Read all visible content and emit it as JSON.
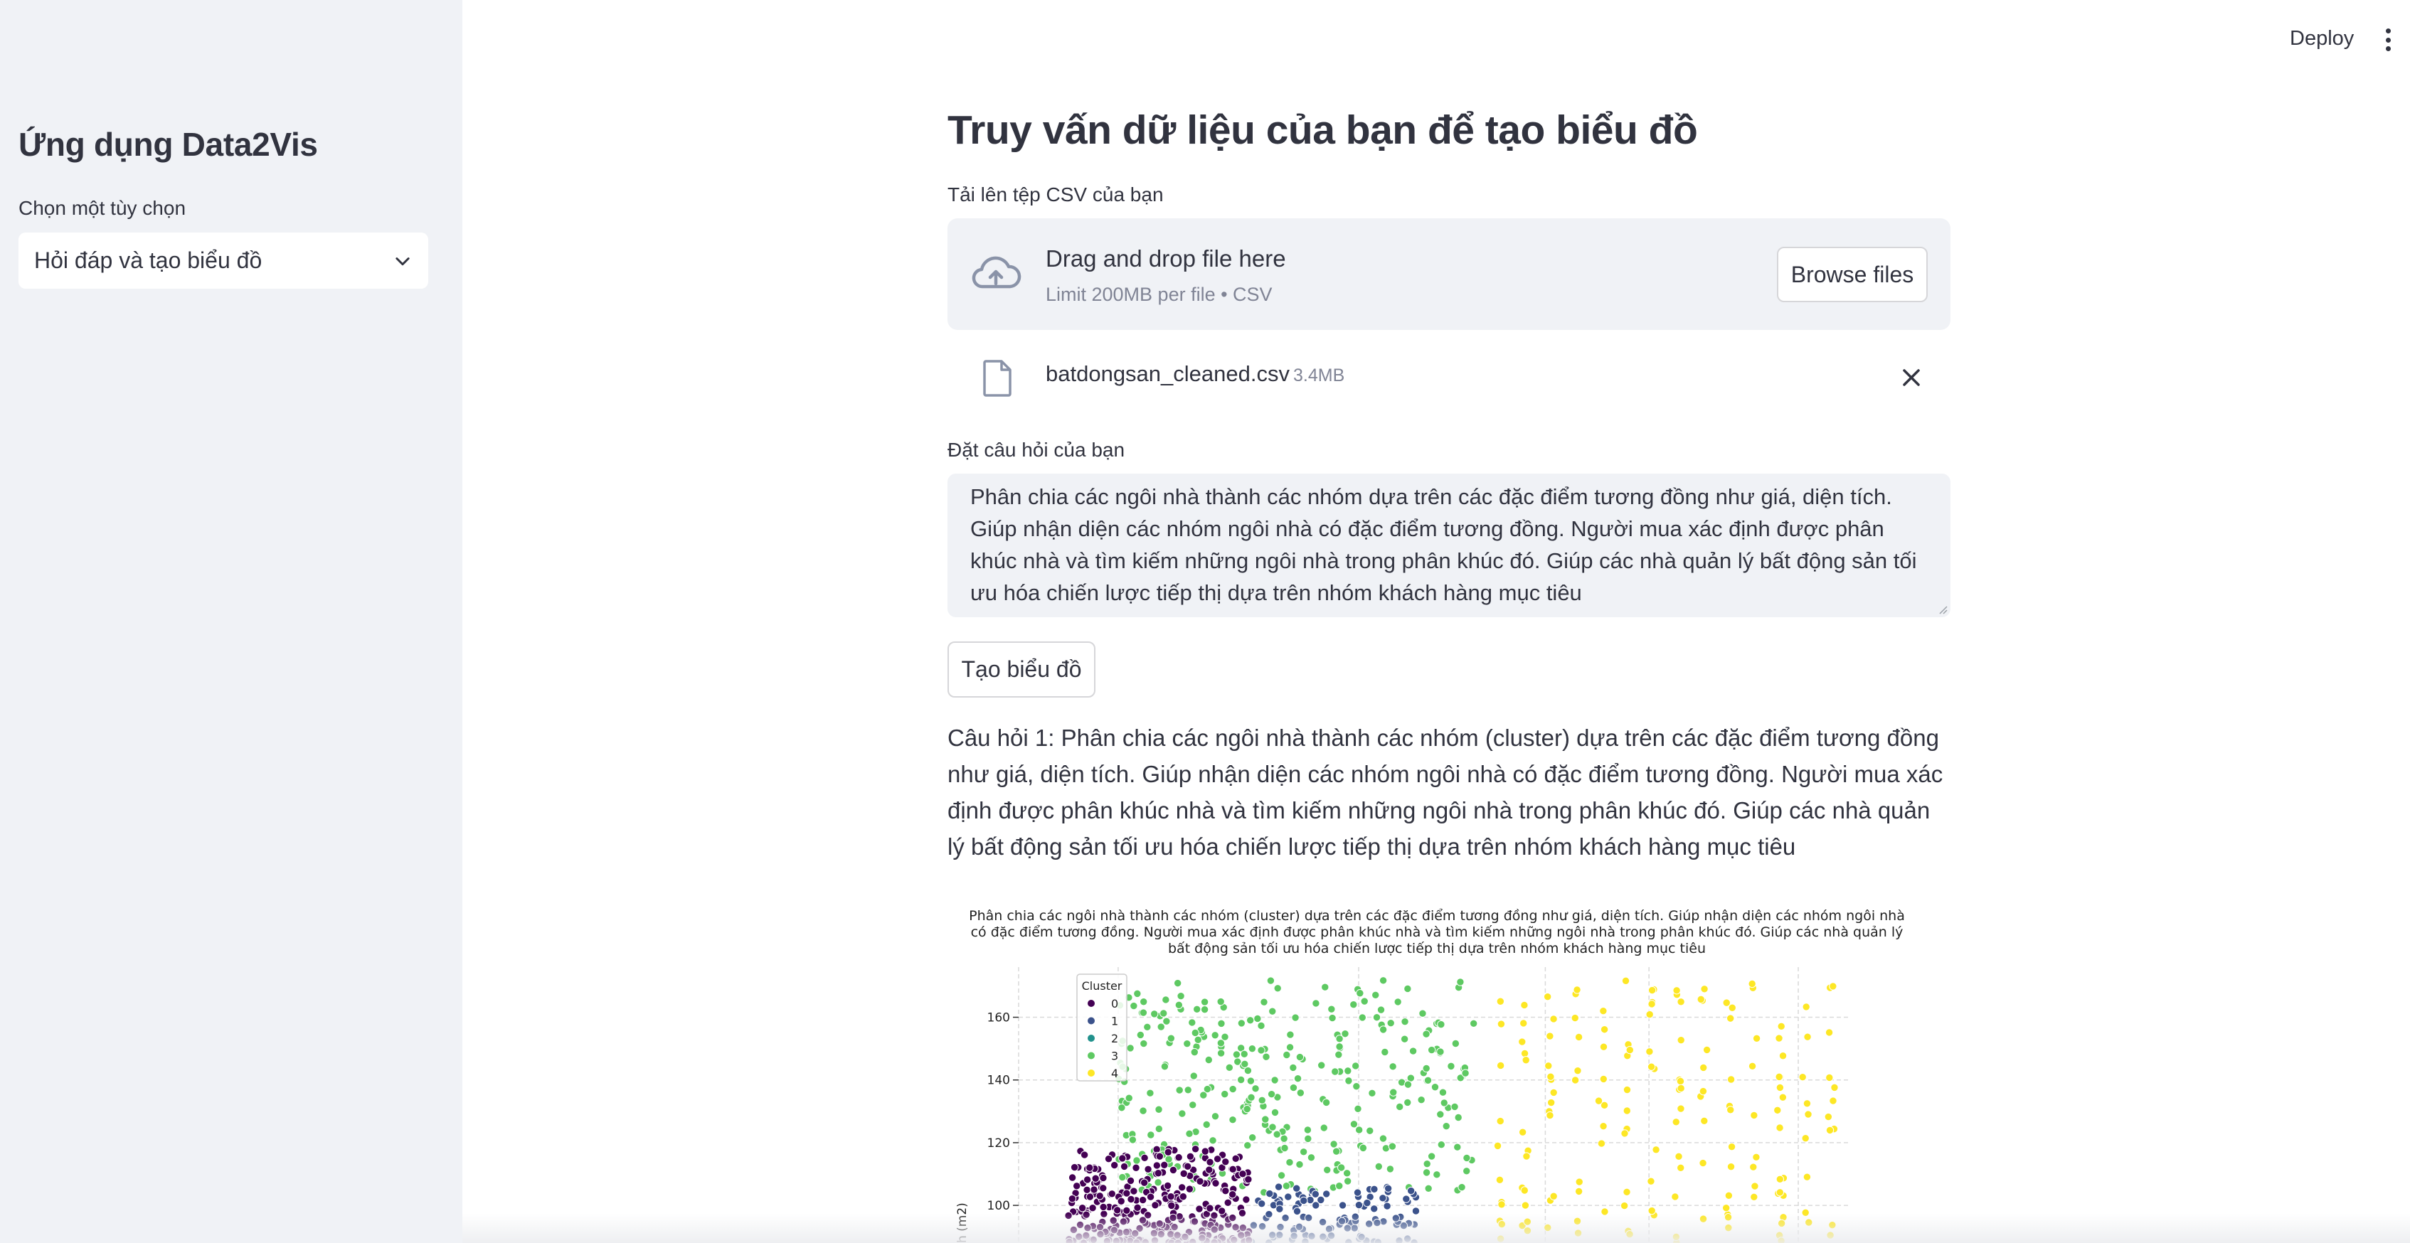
{
  "sidebar": {
    "title": "Ứng dụng Data2Vis",
    "select_label": "Chọn một tùy chọn",
    "select_value": "Hỏi đáp và tạo biểu đồ",
    "select_icon": "chevron-down-icon"
  },
  "header": {
    "deploy_label": "Deploy",
    "menu_icon": "kebab-menu-icon"
  },
  "main": {
    "title": "Truy vấn dữ liệu của bạn để tạo biểu đồ",
    "upload": {
      "label": "Tải lên tệp CSV của bạn",
      "drop_text": "Drag and drop file here",
      "limit_text": "Limit 200MB per file • CSV",
      "browse_label": "Browse files",
      "icon": "cloud-upload-icon"
    },
    "uploaded_file": {
      "name": "batdongsan_cleaned.csv",
      "size": "3.4MB"
    },
    "question": {
      "label": "Đặt câu hỏi của bạn",
      "value": "Phân chia các ngôi nhà thành các nhóm dựa trên các đặc điểm tương đồng như giá, diện tích. Giúp nhận diện các nhóm ngôi nhà có đặc điểm tương đồng. Người mua xác định được phân khúc nhà và tìm kiếm những ngôi nhà trong phân khúc đó. Giúp các nhà quản lý bất động sản tối ưu hóa chiến lược tiếp thị dựa trên nhóm khách hàng mục tiêu"
    },
    "generate_label": "Tạo biểu đồ",
    "answer_text": "Câu hỏi 1: Phân chia các ngôi nhà thành các nhóm (cluster) dựa trên các đặc điểm tương đồng như giá, diện tích. Giúp nhận diện các nhóm ngôi nhà có đặc điểm tương đồng. Người mua xác định được phân khúc nhà và tìm kiếm những ngôi nhà trong phân khúc đó. Giúp các nhà quản lý bất động sản tối ưu hóa chiến lược tiếp thị dựa trên nhóm khách hàng mục tiêu"
  },
  "chart_data": {
    "type": "scatter",
    "title_lines": [
      "Phân chia các ngôi nhà thành các nhóm (cluster) dựa trên các đặc điểm tương đồng như giá, diện tích. Giúp nhận diện các nhóm ngôi nhà",
      "có đặc điểm tương đồng. Người mua xác định được phân khúc nhà và tìm kiếm những ngôi nhà trong phân khúc đó. Giúp các nhà quản lý",
      "bất động sản tối ưu hóa chiến lược tiếp thị dựa trên nhóm khách hàng mục tiêu"
    ],
    "ylabel": "tích (m2)",
    "yticks": [
      100,
      120,
      140,
      160
    ],
    "ylim_visible": [
      88,
      176
    ],
    "grid": true,
    "legend": {
      "title": "Cluster",
      "placement": "top-left",
      "labels": [
        "0",
        "1",
        "2",
        "3",
        "4"
      ]
    },
    "series": [
      {
        "name": "0",
        "color": "#440154"
      },
      {
        "name": "1",
        "color": "#3b528b"
      },
      {
        "name": "2",
        "color": "#21918c"
      },
      {
        "name": "3",
        "color": "#5ec962"
      },
      {
        "name": "4",
        "color": "#fde725"
      }
    ],
    "cluster_regions": [
      {
        "cluster": "0",
        "x_range": [
          0.06,
          0.28
        ],
        "y_range": [
          88,
          118
        ],
        "count": 320
      },
      {
        "cluster": "1",
        "x_range": [
          0.28,
          0.48
        ],
        "y_range": [
          88,
          106
        ],
        "count": 110
      },
      {
        "cluster": "3",
        "x_range": [
          0.12,
          0.55
        ],
        "y_range": [
          104,
          172
        ],
        "count": 300
      },
      {
        "cluster": "4",
        "x_range": [
          0.58,
          0.98
        ],
        "y_range": [
          88,
          172
        ],
        "count": 170
      }
    ]
  }
}
